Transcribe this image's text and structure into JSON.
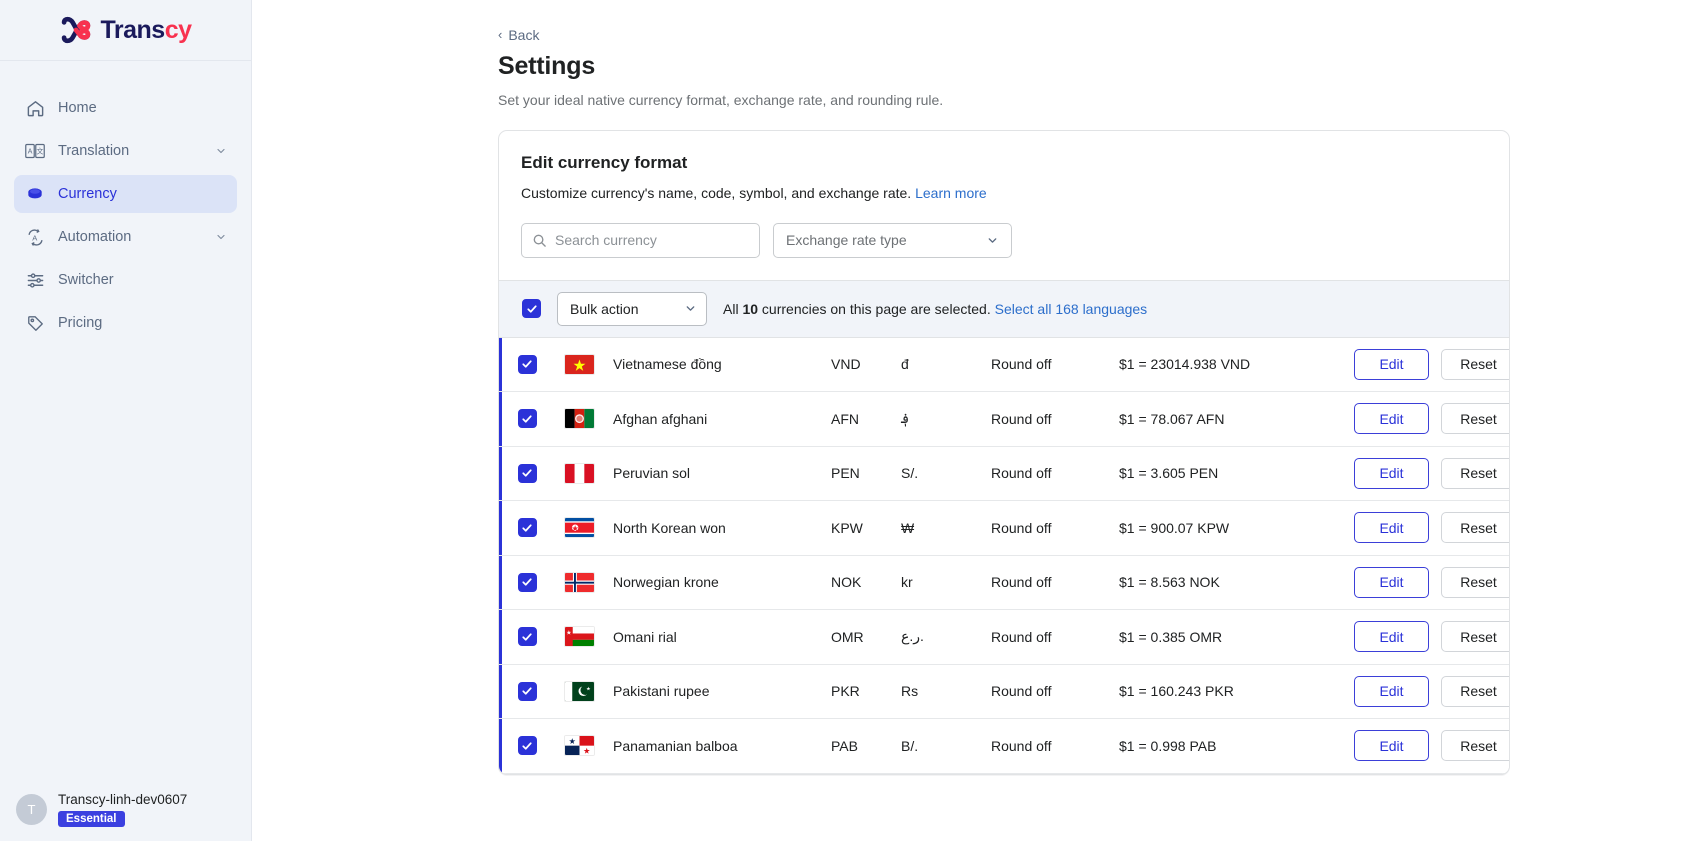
{
  "brand": {
    "name_dark": "Trans",
    "name_pink": "cy",
    "logo_icon": "transcy-knot-logo"
  },
  "sidebar": {
    "items": [
      {
        "label": "Home",
        "icon": "home-icon",
        "active": false,
        "expandable": false
      },
      {
        "label": "Translation",
        "icon": "translate-icon",
        "active": false,
        "expandable": true
      },
      {
        "label": "Currency",
        "icon": "coins-icon",
        "active": true,
        "expandable": false
      },
      {
        "label": "Automation",
        "icon": "automation-icon",
        "active": false,
        "expandable": true
      },
      {
        "label": "Switcher",
        "icon": "sliders-icon",
        "active": false,
        "expandable": false
      },
      {
        "label": "Pricing",
        "icon": "tag-icon",
        "active": false,
        "expandable": false
      }
    ],
    "user": {
      "avatar_initial": "T",
      "name": "Transcy-linh-dev0607",
      "plan": "Essential"
    }
  },
  "header": {
    "back_label": "Back",
    "title": "Settings",
    "subtitle": "Set your ideal native currency format, exchange rate, and rounding rule."
  },
  "card": {
    "title": "Edit currency format",
    "description": "Customize currency's name, code, symbol, and exchange rate.",
    "learn_more": "Learn more"
  },
  "filters": {
    "search_placeholder": "Search currency",
    "search_value": "",
    "search_icon": "search-icon",
    "exchange_rate_type_label": "Exchange rate type",
    "exchange_rate_type_options": [
      "Exchange rate type"
    ]
  },
  "bulk": {
    "checkbox_checked": true,
    "action_label": "Bulk action",
    "action_options": [
      "Bulk action"
    ],
    "summary_prefix": "All ",
    "summary_count": "10",
    "summary_suffix": " currencies on this page are selected.",
    "select_all_link": "Select all 168 languages"
  },
  "table": {
    "edit_label": "Edit",
    "reset_label": "Reset",
    "rows": [
      {
        "flag": "vn",
        "name": "Vietnamese đồng",
        "code": "VND",
        "symbol": "đ",
        "rounding": "Round off",
        "rate": "$1 = 23014.938 VND",
        "checked": true
      },
      {
        "flag": "af",
        "name": "Afghan afghani",
        "code": "AFN",
        "symbol": "؋",
        "rounding": "Round off",
        "rate": "$1 = 78.067 AFN",
        "checked": true
      },
      {
        "flag": "pe",
        "name": "Peruvian sol",
        "code": "PEN",
        "symbol": "S/.",
        "rounding": "Round off",
        "rate": "$1 = 3.605 PEN",
        "checked": true
      },
      {
        "flag": "kp",
        "name": "North Korean won",
        "code": "KPW",
        "symbol": "₩",
        "rounding": "Round off",
        "rate": "$1 = 900.07 KPW",
        "checked": true
      },
      {
        "flag": "no",
        "name": "Norwegian krone",
        "code": "NOK",
        "symbol": "kr",
        "rounding": "Round off",
        "rate": "$1 = 8.563 NOK",
        "checked": true
      },
      {
        "flag": "om",
        "name": "Omani rial",
        "code": "OMR",
        "symbol": "ر.ع.",
        "rounding": "Round off",
        "rate": "$1 = 0.385 OMR",
        "checked": true
      },
      {
        "flag": "pk",
        "name": "Pakistani rupee",
        "code": "PKR",
        "symbol": "Rs",
        "rounding": "Round off",
        "rate": "$1 = 160.243 PKR",
        "checked": true
      },
      {
        "flag": "pa",
        "name": "Panamanian balboa",
        "code": "PAB",
        "symbol": "B/.",
        "rounding": "Round off",
        "rate": "$1 = 0.998 PAB",
        "checked": true
      }
    ]
  },
  "colors": {
    "accent": "#2b32d8",
    "brand_pink": "#f8324f",
    "brand_navy": "#1b1a5c",
    "link": "#2c6ecb",
    "sidebar_bg": "#f1f4f9"
  }
}
